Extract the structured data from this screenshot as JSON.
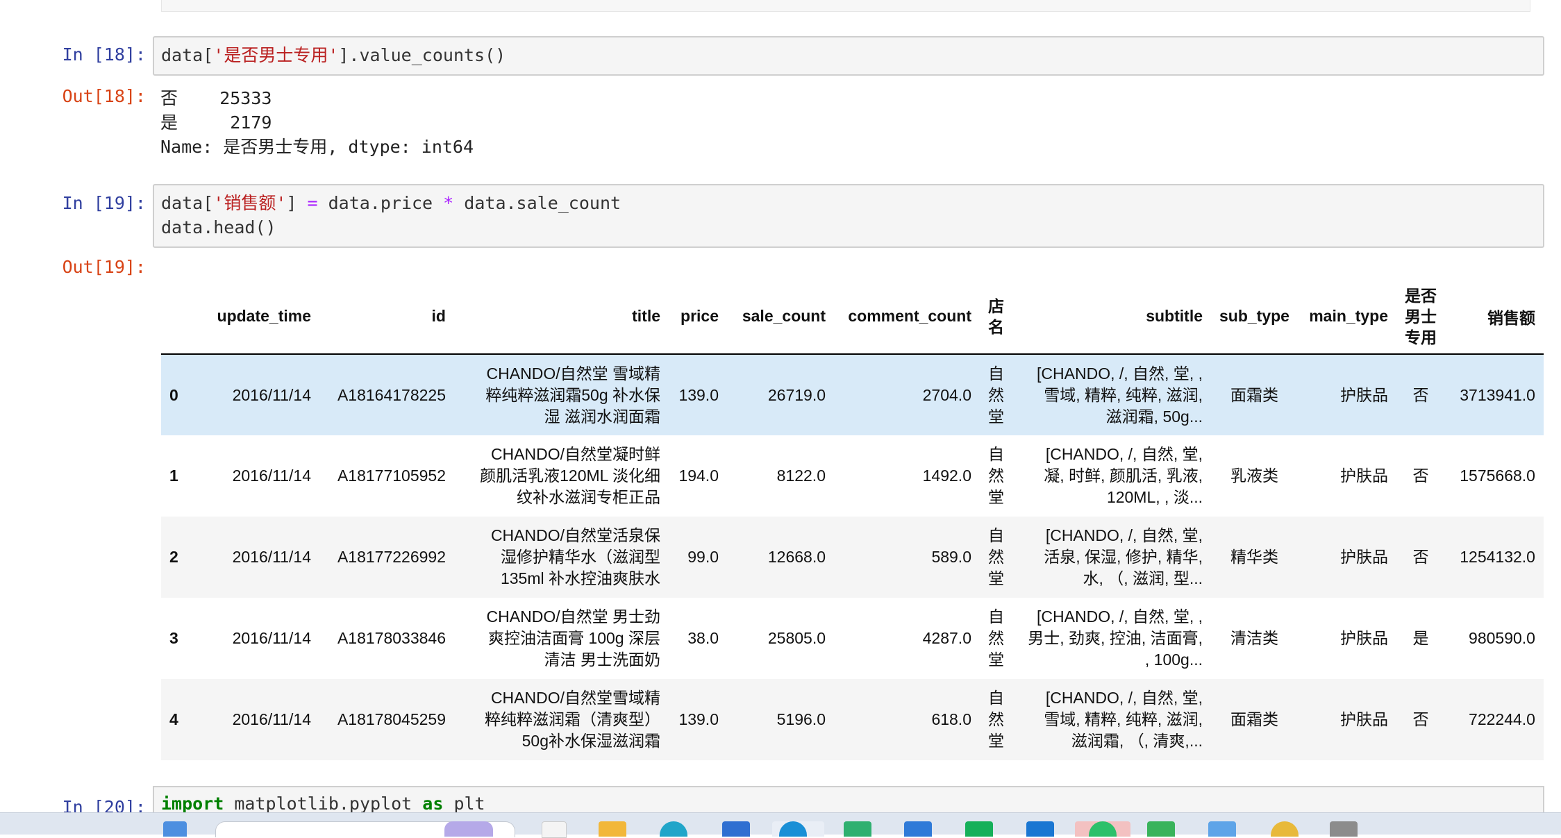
{
  "cells": {
    "c18": {
      "in_prompt": "In  [18]:",
      "code": {
        "p1": "data[",
        "s1": "'是否男士专用'",
        "p2": "].value_counts()"
      },
      "out_prompt": "Out[18]:",
      "output_lines": [
        "否    25333",
        "是     2179",
        "Name: 是否男士专用, dtype: int64"
      ]
    },
    "c19": {
      "in_prompt": "In  [19]:",
      "code": {
        "p1": "data[",
        "s1": "'销售额'",
        "p2": "] ",
        "op1": "=",
        "p3": " data.price ",
        "op2": "*",
        "p4": " data.sale_count",
        "line2": "data.head()"
      },
      "out_prompt": "Out[19]:"
    },
    "c20": {
      "in_prompt": "In  [20]:",
      "code": {
        "kw1": "import",
        "p1": " matplotlib.pyplot ",
        "kw2": "as",
        "p2": " plt"
      }
    }
  },
  "table": {
    "columns": [
      "",
      "update_time",
      "id",
      "title",
      "price",
      "sale_count",
      "comment_count",
      "店\n名",
      "subtitle",
      "sub_type",
      "main_type",
      "是否\n男士\n专用",
      "销售额"
    ],
    "rows": [
      [
        "0",
        "2016/11/14",
        "A18164178225",
        "CHANDO/自然堂 雪域精\n粹纯粹滋润霜50g 补水保\n湿 滋润水润面霜",
        "139.0",
        "26719.0",
        "2704.0",
        "自\n然\n堂",
        "[CHANDO, /, 自然, 堂, ,\n雪域, 精粹, 纯粹, 滋润,\n滋润霜, 50g...",
        "面霜类",
        "护肤品",
        "否",
        "3713941.0"
      ],
      [
        "1",
        "2016/11/14",
        "A18177105952",
        "CHANDO/自然堂凝时鲜\n颜肌活乳液120ML 淡化细\n纹补水滋润专柜正品",
        "194.0",
        "8122.0",
        "1492.0",
        "自\n然\n堂",
        "[CHANDO, /, 自然, 堂,\n凝, 时鲜, 颜肌活, 乳液,\n120ML, , 淡...",
        "乳液类",
        "护肤品",
        "否",
        "1575668.0"
      ],
      [
        "2",
        "2016/11/14",
        "A18177226992",
        "CHANDO/自然堂活泉保\n湿修护精华水（滋润型\n135ml 补水控油爽肤水",
        "99.0",
        "12668.0",
        "589.0",
        "自\n然\n堂",
        "[CHANDO, /, 自然, 堂,\n活泉, 保湿, 修护, 精华,\n水, （, 滋润, 型...",
        "精华类",
        "护肤品",
        "否",
        "1254132.0"
      ],
      [
        "3",
        "2016/11/14",
        "A18178033846",
        "CHANDO/自然堂 男士劲\n爽控油洁面膏 100g 深层\n清洁 男士洗面奶",
        "38.0",
        "25805.0",
        "4287.0",
        "自\n然\n堂",
        "[CHANDO, /, 自然, 堂, ,\n男士, 劲爽, 控油, 洁面膏,\n, 100g...",
        "清洁类",
        "护肤品",
        "是",
        "980590.0"
      ],
      [
        "4",
        "2016/11/14",
        "A18178045259",
        "CHANDO/自然堂雪域精\n粹纯粹滋润霜（清爽型）\n50g补水保湿滋润霜",
        "139.0",
        "5196.0",
        "618.0",
        "自\n然\n堂",
        "[CHANDO, /, 自然, 堂,\n雪域, 精粹, 纯粹, 滋润,\n滋润霜, （, 清爽,...",
        "面霜类",
        "护肤品",
        "否",
        "722244.0"
      ]
    ]
  },
  "taskbar": {
    "icons": [
      "windows-start-icon",
      "search-box",
      "widget-icon",
      "file-icon",
      "folder-icon",
      "edge-icon",
      "store-icon",
      "browser-icon",
      "spreadsheet-icon",
      "shield-icon",
      "chat-icon",
      "mail-icon",
      "wechat-icon",
      "app-icon",
      "explorer-icon",
      "chrome-icon",
      "window-icon"
    ],
    "colors": {
      "bg": "#dfe6f0",
      "active": "#f3c1c1"
    }
  }
}
